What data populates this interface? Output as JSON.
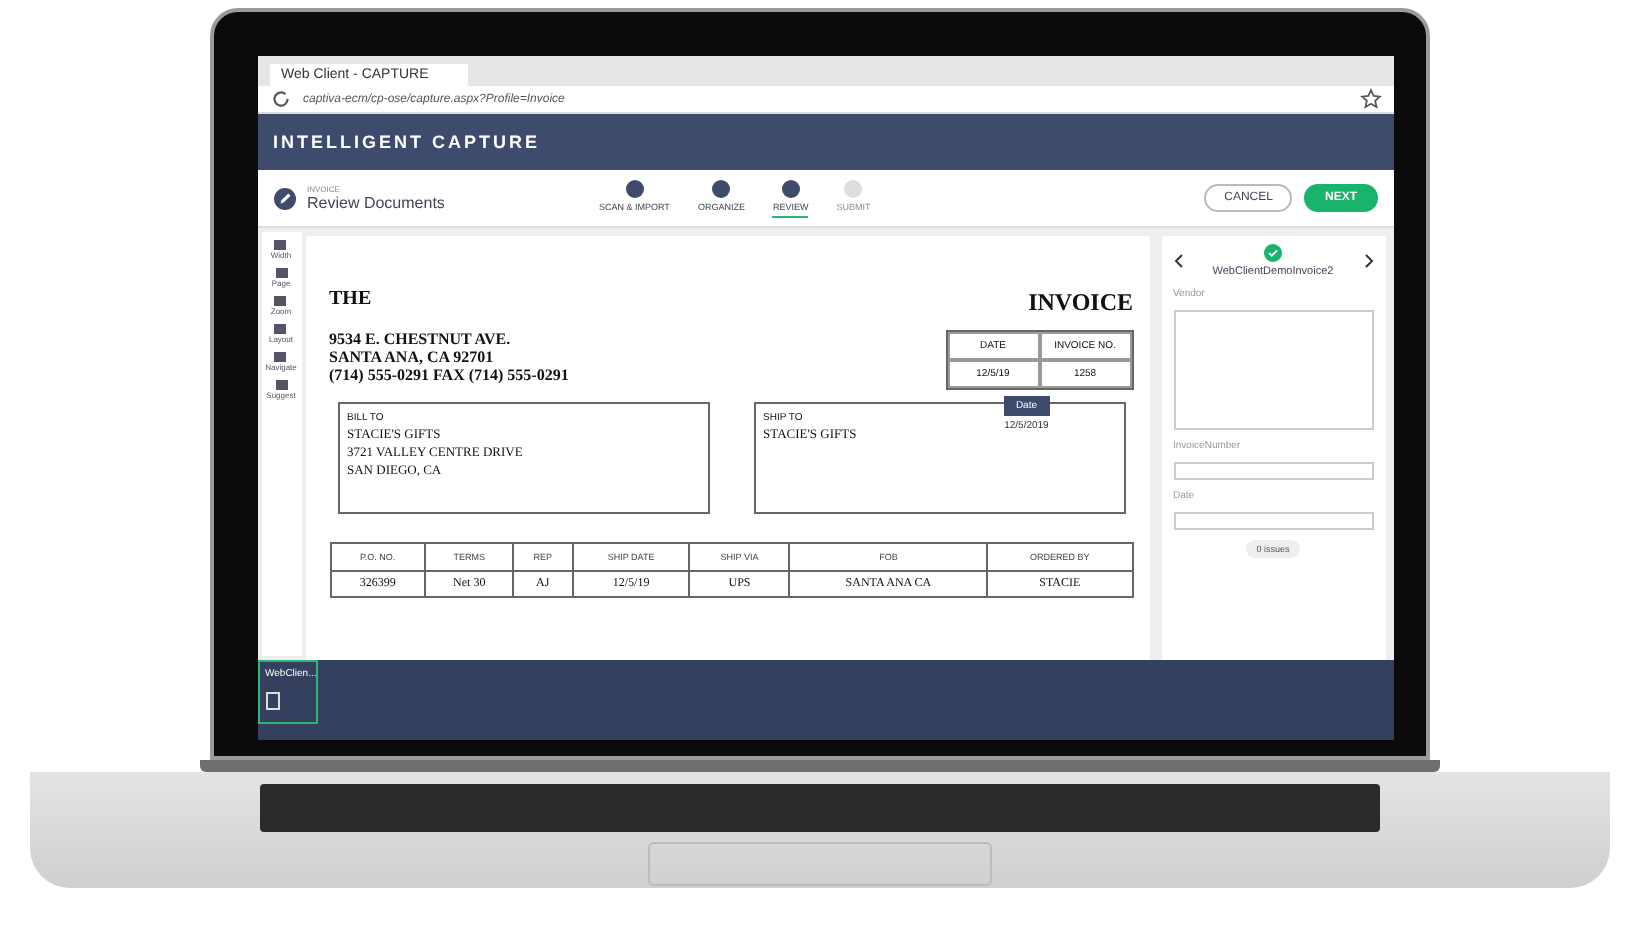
{
  "browser": {
    "tab_title": "Web Client - CAPTURE",
    "url": "captiva-ecm/cp-ose/capture.aspx?Profile=Invoice"
  },
  "app": {
    "title": "INTELLIGENT CAPTURE",
    "page_caption": "INVOICE",
    "page_title": "Review Documents"
  },
  "steps": [
    {
      "label": "SCAN & IMPORT",
      "selected": false,
      "disabled": false
    },
    {
      "label": "ORGANIZE",
      "selected": false,
      "disabled": false
    },
    {
      "label": "REVIEW",
      "selected": true,
      "disabled": false
    },
    {
      "label": "SUBMIT",
      "selected": false,
      "disabled": true
    }
  ],
  "buttons": [
    {
      "label": "CANCEL",
      "kind": "outline"
    },
    {
      "label": "NEXT",
      "kind": "primary"
    }
  ],
  "tools": [
    "Width",
    "Page",
    "Zoom",
    "Layout",
    "Navigate",
    "Suggest"
  ],
  "invoice": {
    "company": "THE",
    "heading": "INVOICE",
    "address": [
      "9534 E. CHESTNUT AVE.",
      "SANTA ANA, CA 92701",
      "(714) 555-0291  FAX (714) 555-0291"
    ],
    "meta_headers": [
      "DATE",
      "INVOICE NO."
    ],
    "meta_values": [
      "12/5/19",
      "1258"
    ],
    "tooltip": {
      "label": "Date",
      "value": "12/5/2019"
    },
    "bill_to": {
      "heading": "BILL TO",
      "lines": [
        "STACIE'S GIFTS",
        "3721 VALLEY CENTRE DRIVE",
        "SAN DIEGO, CA"
      ]
    },
    "ship_to": {
      "heading": "SHIP TO",
      "lines": [
        "STACIE'S GIFTS"
      ]
    },
    "table": {
      "columns": [
        "P.O. NO.",
        "TERMS",
        "REP",
        "SHIP DATE",
        "SHIP VIA",
        "FOB",
        "ORDERED BY"
      ],
      "rows": [
        [
          "326399",
          "Net 30",
          "AJ",
          "12/5/19",
          "UPS",
          "SANTA ANA CA",
          "STACIE"
        ]
      ]
    }
  },
  "panel": {
    "document": "WebClientDemoInvoice2",
    "fields": [
      {
        "label": "Vendor",
        "kind": "area"
      },
      {
        "label": "InvoiceNumber",
        "kind": "line"
      },
      {
        "label": "Date",
        "kind": "line"
      }
    ],
    "issues": "0 issues"
  },
  "taskbar": {
    "window": "WebClien..."
  }
}
